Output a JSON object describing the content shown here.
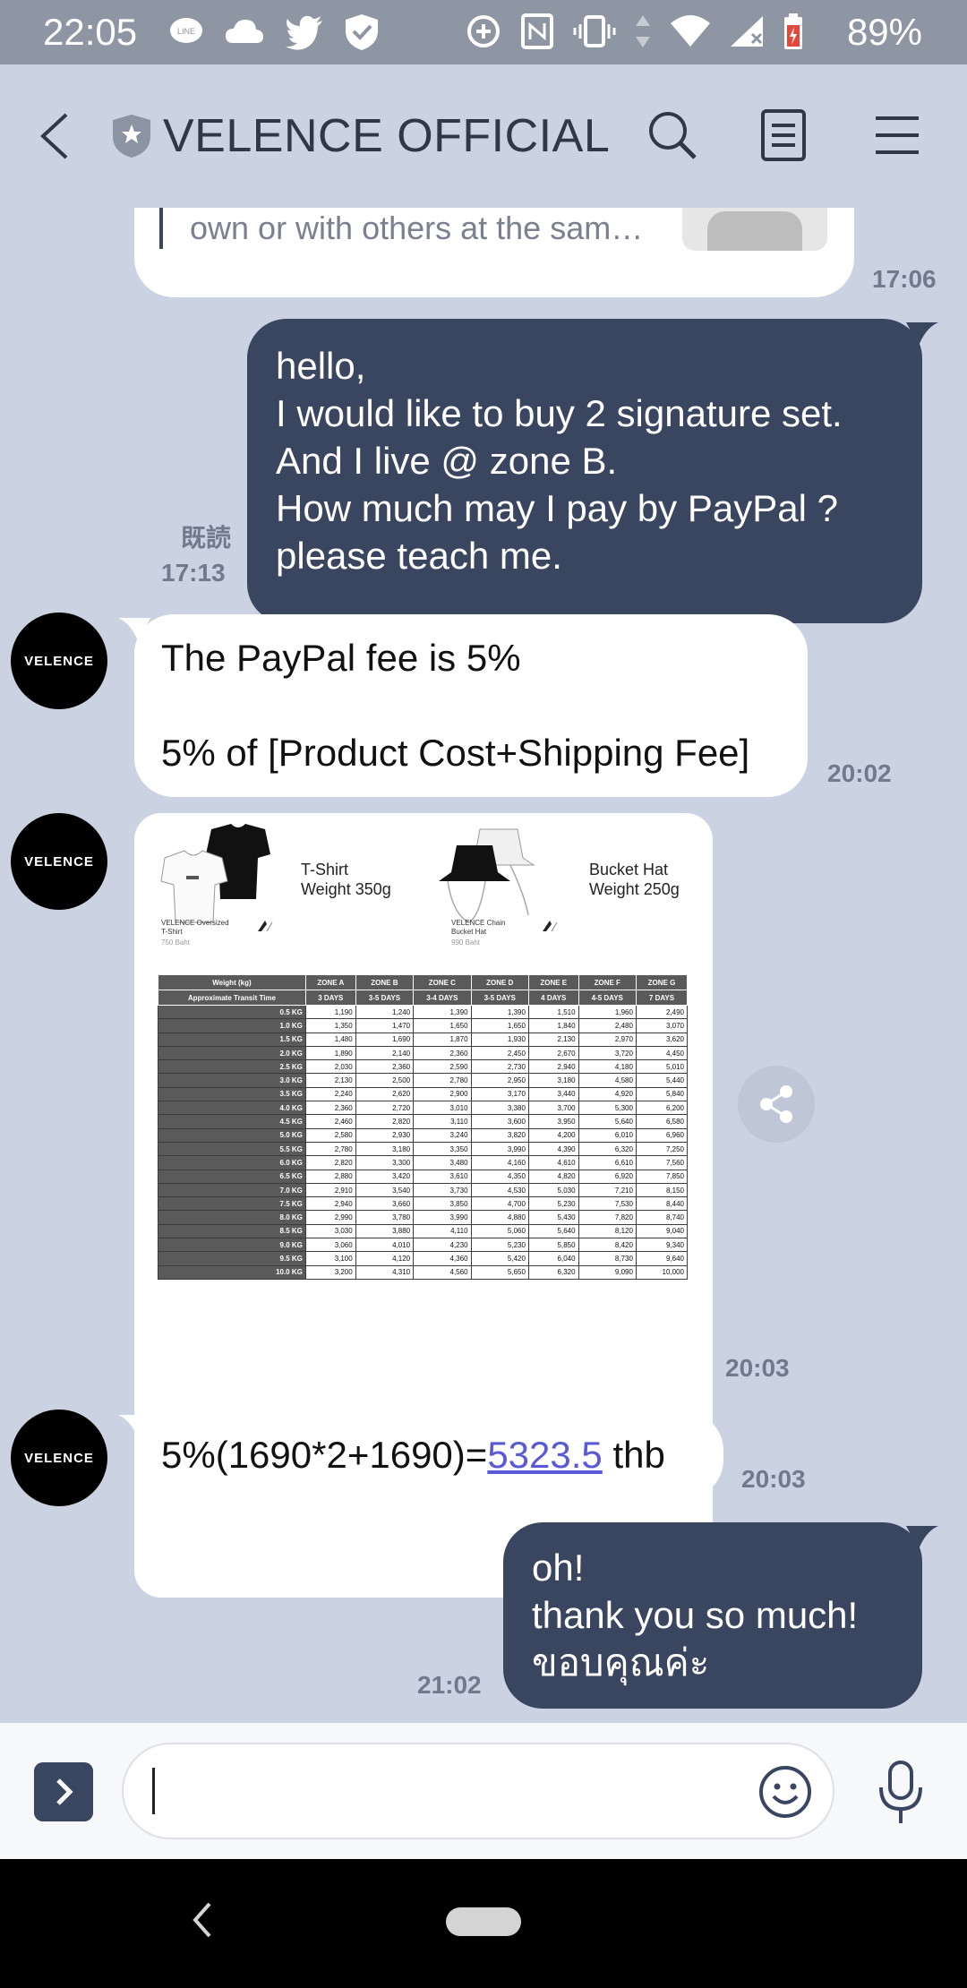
{
  "status_bar": {
    "time": "22:05",
    "battery": "89%",
    "left_icons": [
      "line-icon",
      "cloud-icon",
      "twitter-icon",
      "shield-check-icon"
    ],
    "right_icons": [
      "data-saver-icon",
      "nfc-icon",
      "vibrate-icon",
      "data-arrows-icon",
      "wifi-icon",
      "signal-icon",
      "battery-icon"
    ]
  },
  "header": {
    "title": "VELENCE OFFICIAL"
  },
  "messages": {
    "m0": {
      "text": "own or with others at the sam…",
      "time": "17:06"
    },
    "m1": {
      "line1": "hello,",
      "line2": "I would like to buy 2 signature set.",
      "line3": "And I live @ zone B.",
      "line4": "How much may I pay by PayPal ?",
      "line5": "please teach me.",
      "read": "既読",
      "time": "17:13"
    },
    "m2": {
      "line1": "The PayPal fee is 5%",
      "line2": "5% of [Product Cost+Shipping Fee]",
      "time": "20:02",
      "avatar": "VELENCE"
    },
    "m3": {
      "time": "20:03",
      "avatar": "VELENCE",
      "image": {
        "tshirt_title": "T-Shirt",
        "tshirt_weight": "Weight 350g",
        "tshirt_name": "VELENCE Oversized T-Shirt",
        "tshirt_price": "750 Baht",
        "hat_title": "Bucket Hat",
        "hat_weight": "Weight 250g",
        "hat_name": "VELENCE Chain Bucket Hat",
        "hat_price": "990 Baht",
        "table": {
          "h0": "Weight (kg)",
          "h1": "ZONE A",
          "h2": "ZONE B",
          "h3": "ZONE C",
          "h4": "ZONE D",
          "h5": "ZONE E",
          "h6": "ZONE F",
          "h7": "ZONE G",
          "t0": "Approximate Transit Time",
          "t1": "3 DAYS",
          "t2": "3-5 DAYS",
          "t3": "3-4 DAYS",
          "t4": "3-5 DAYS",
          "t5": "4 DAYS",
          "t6": "4-5 DAYS",
          "t7": "7 DAYS",
          "rows": [
            [
              "0.5 KG",
              "1,190",
              "1,240",
              "1,390",
              "1,390",
              "1,510",
              "1,960",
              "2,490"
            ],
            [
              "1.0 KG",
              "1,350",
              "1,470",
              "1,650",
              "1,650",
              "1,840",
              "2,480",
              "3,070"
            ],
            [
              "1.5 KG",
              "1,480",
              "1,690",
              "1,870",
              "1,930",
              "2,130",
              "2,970",
              "3,620"
            ],
            [
              "2.0 KG",
              "1,890",
              "2,140",
              "2,360",
              "2,450",
              "2,670",
              "3,720",
              "4,450"
            ],
            [
              "2.5 KG",
              "2,030",
              "2,360",
              "2,590",
              "2,730",
              "2,940",
              "4,180",
              "5,010"
            ],
            [
              "3.0 KG",
              "2,130",
              "2,500",
              "2,780",
              "2,950",
              "3,180",
              "4,580",
              "5,440"
            ],
            [
              "3.5 KG",
              "2,240",
              "2,620",
              "2,900",
              "3,170",
              "3,440",
              "4,920",
              "5,840"
            ],
            [
              "4.0 KG",
              "2,360",
              "2,720",
              "3,010",
              "3,380",
              "3,700",
              "5,300",
              "6,200"
            ],
            [
              "4.5 KG",
              "2,460",
              "2,820",
              "3,110",
              "3,600",
              "3,950",
              "5,640",
              "6,580"
            ],
            [
              "5.0 KG",
              "2,580",
              "2,930",
              "3,240",
              "3,820",
              "4,200",
              "6,010",
              "6,960"
            ],
            [
              "5.5 KG",
              "2,780",
              "3,180",
              "3,350",
              "3,990",
              "4,390",
              "6,320",
              "7,250"
            ],
            [
              "6.0 KG",
              "2,820",
              "3,300",
              "3,480",
              "4,160",
              "4,610",
              "6,610",
              "7,560"
            ],
            [
              "6.5 KG",
              "2,880",
              "3,420",
              "3,610",
              "4,350",
              "4,820",
              "6,920",
              "7,850"
            ],
            [
              "7.0 KG",
              "2,910",
              "3,540",
              "3,730",
              "4,530",
              "5,030",
              "7,210",
              "8,150"
            ],
            [
              "7.5 KG",
              "2,940",
              "3,660",
              "3,850",
              "4,700",
              "5,230",
              "7,530",
              "8,440"
            ],
            [
              "8.0 KG",
              "2,990",
              "3,780",
              "3,990",
              "4,880",
              "5,430",
              "7,820",
              "8,740"
            ],
            [
              "8.5 KG",
              "3,030",
              "3,880",
              "4,110",
              "5,060",
              "5,640",
              "8,120",
              "9,040"
            ],
            [
              "9.0 KG",
              "3,060",
              "4,010",
              "4,230",
              "5,230",
              "5,850",
              "8,420",
              "9,340"
            ],
            [
              "9.5 KG",
              "3,100",
              "4,120",
              "4,360",
              "5,420",
              "6,040",
              "8,730",
              "9,640"
            ],
            [
              "10.0 KG",
              "3,200",
              "4,310",
              "4,560",
              "5,650",
              "6,320",
              "9,090",
              "10,000"
            ]
          ]
        }
      }
    },
    "m4": {
      "prefix": "5%(1690*2+1690)=",
      "link": "5323.5",
      "suffix": " thb",
      "time": "20:03",
      "avatar": "VELENCE"
    },
    "m5": {
      "line1": "oh!",
      "line2": "thank you so much!",
      "line3": "ขอบคุณค่ะ",
      "time": "21:02"
    }
  },
  "input": {
    "value": "",
    "placeholder": ""
  },
  "colors": {
    "chat_bg": "#cbd3e2",
    "outgoing_bubble": "#3a4560",
    "incoming_bubble": "#ffffff",
    "link": "#5a5ad6"
  }
}
